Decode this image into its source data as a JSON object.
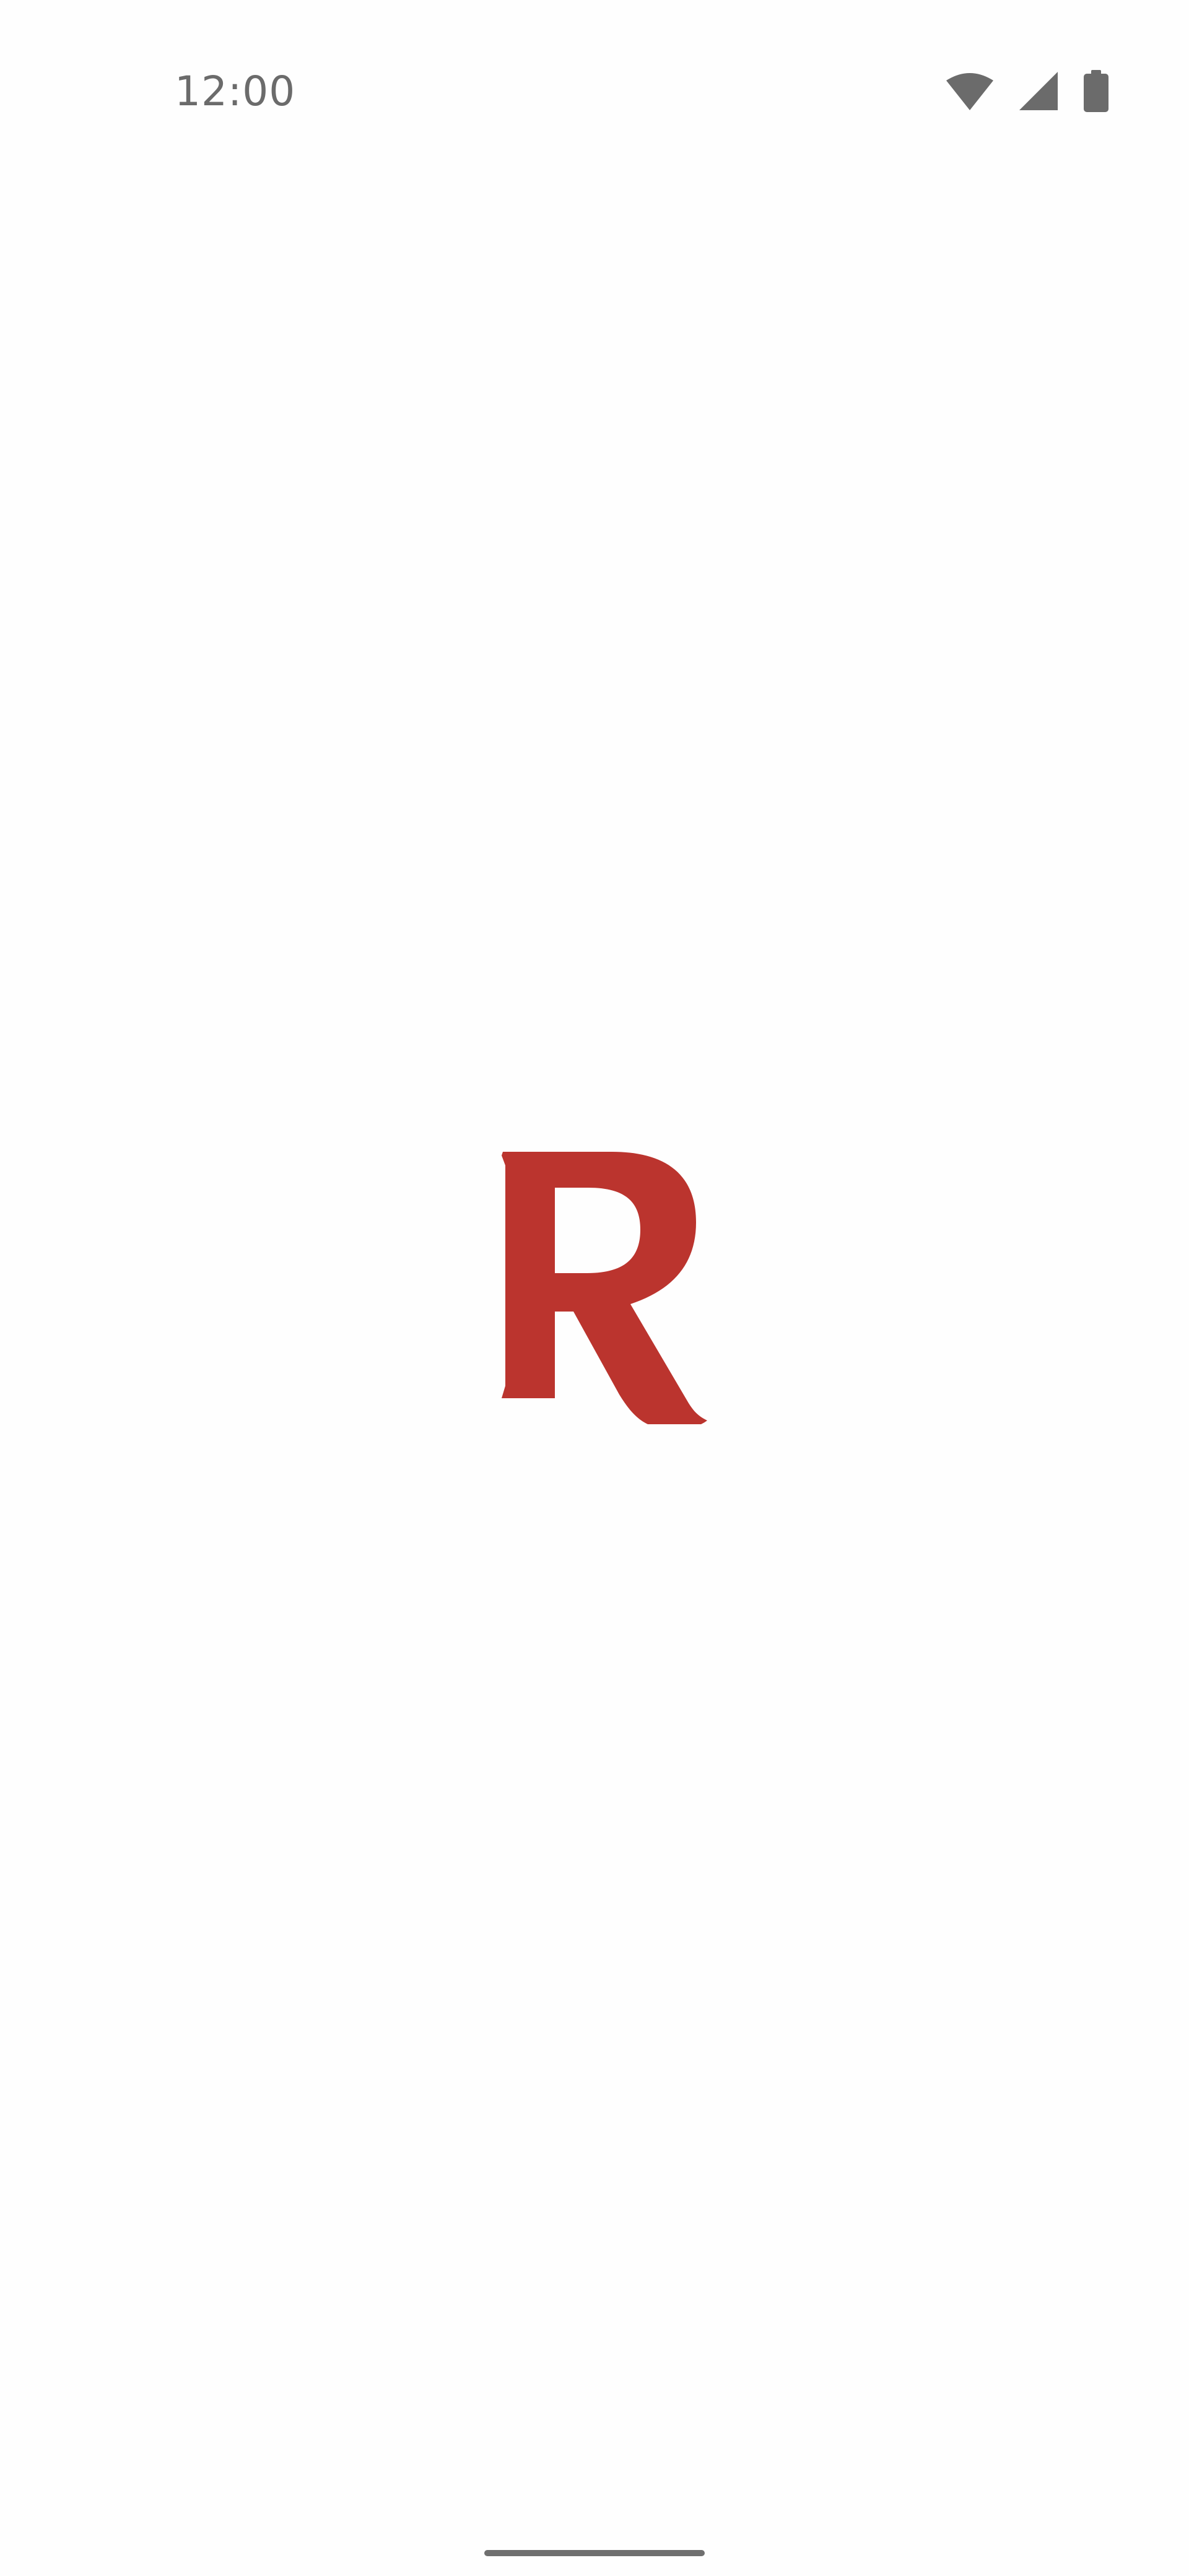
{
  "status_bar": {
    "time": "12:00",
    "icons": [
      "wifi-icon",
      "cell-signal-icon",
      "battery-icon"
    ],
    "icon_color": "#6b6b6b"
  },
  "splash": {
    "logo_letter": "R",
    "logo_color": "#bb342e",
    "background_color": "#fefefe"
  },
  "navigation": {
    "home_indicator_color": "#6f6f6f"
  }
}
